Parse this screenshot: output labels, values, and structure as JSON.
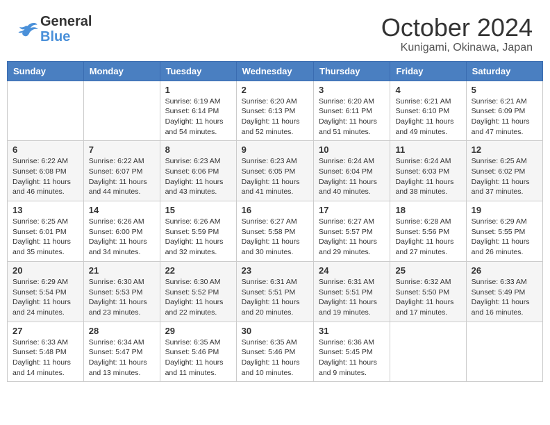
{
  "header": {
    "logo_general": "General",
    "logo_blue": "Blue",
    "month": "October 2024",
    "location": "Kunigami, Okinawa, Japan"
  },
  "calendar": {
    "days_of_week": [
      "Sunday",
      "Monday",
      "Tuesday",
      "Wednesday",
      "Thursday",
      "Friday",
      "Saturday"
    ],
    "weeks": [
      [
        {
          "day": "",
          "info": ""
        },
        {
          "day": "",
          "info": ""
        },
        {
          "day": "1",
          "info": "Sunrise: 6:19 AM\nSunset: 6:14 PM\nDaylight: 11 hours and 54 minutes."
        },
        {
          "day": "2",
          "info": "Sunrise: 6:20 AM\nSunset: 6:13 PM\nDaylight: 11 hours and 52 minutes."
        },
        {
          "day": "3",
          "info": "Sunrise: 6:20 AM\nSunset: 6:11 PM\nDaylight: 11 hours and 51 minutes."
        },
        {
          "day": "4",
          "info": "Sunrise: 6:21 AM\nSunset: 6:10 PM\nDaylight: 11 hours and 49 minutes."
        },
        {
          "day": "5",
          "info": "Sunrise: 6:21 AM\nSunset: 6:09 PM\nDaylight: 11 hours and 47 minutes."
        }
      ],
      [
        {
          "day": "6",
          "info": "Sunrise: 6:22 AM\nSunset: 6:08 PM\nDaylight: 11 hours and 46 minutes."
        },
        {
          "day": "7",
          "info": "Sunrise: 6:22 AM\nSunset: 6:07 PM\nDaylight: 11 hours and 44 minutes."
        },
        {
          "day": "8",
          "info": "Sunrise: 6:23 AM\nSunset: 6:06 PM\nDaylight: 11 hours and 43 minutes."
        },
        {
          "day": "9",
          "info": "Sunrise: 6:23 AM\nSunset: 6:05 PM\nDaylight: 11 hours and 41 minutes."
        },
        {
          "day": "10",
          "info": "Sunrise: 6:24 AM\nSunset: 6:04 PM\nDaylight: 11 hours and 40 minutes."
        },
        {
          "day": "11",
          "info": "Sunrise: 6:24 AM\nSunset: 6:03 PM\nDaylight: 11 hours and 38 minutes."
        },
        {
          "day": "12",
          "info": "Sunrise: 6:25 AM\nSunset: 6:02 PM\nDaylight: 11 hours and 37 minutes."
        }
      ],
      [
        {
          "day": "13",
          "info": "Sunrise: 6:25 AM\nSunset: 6:01 PM\nDaylight: 11 hours and 35 minutes."
        },
        {
          "day": "14",
          "info": "Sunrise: 6:26 AM\nSunset: 6:00 PM\nDaylight: 11 hours and 34 minutes."
        },
        {
          "day": "15",
          "info": "Sunrise: 6:26 AM\nSunset: 5:59 PM\nDaylight: 11 hours and 32 minutes."
        },
        {
          "day": "16",
          "info": "Sunrise: 6:27 AM\nSunset: 5:58 PM\nDaylight: 11 hours and 30 minutes."
        },
        {
          "day": "17",
          "info": "Sunrise: 6:27 AM\nSunset: 5:57 PM\nDaylight: 11 hours and 29 minutes."
        },
        {
          "day": "18",
          "info": "Sunrise: 6:28 AM\nSunset: 5:56 PM\nDaylight: 11 hours and 27 minutes."
        },
        {
          "day": "19",
          "info": "Sunrise: 6:29 AM\nSunset: 5:55 PM\nDaylight: 11 hours and 26 minutes."
        }
      ],
      [
        {
          "day": "20",
          "info": "Sunrise: 6:29 AM\nSunset: 5:54 PM\nDaylight: 11 hours and 24 minutes."
        },
        {
          "day": "21",
          "info": "Sunrise: 6:30 AM\nSunset: 5:53 PM\nDaylight: 11 hours and 23 minutes."
        },
        {
          "day": "22",
          "info": "Sunrise: 6:30 AM\nSunset: 5:52 PM\nDaylight: 11 hours and 22 minutes."
        },
        {
          "day": "23",
          "info": "Sunrise: 6:31 AM\nSunset: 5:51 PM\nDaylight: 11 hours and 20 minutes."
        },
        {
          "day": "24",
          "info": "Sunrise: 6:31 AM\nSunset: 5:51 PM\nDaylight: 11 hours and 19 minutes."
        },
        {
          "day": "25",
          "info": "Sunrise: 6:32 AM\nSunset: 5:50 PM\nDaylight: 11 hours and 17 minutes."
        },
        {
          "day": "26",
          "info": "Sunrise: 6:33 AM\nSunset: 5:49 PM\nDaylight: 11 hours and 16 minutes."
        }
      ],
      [
        {
          "day": "27",
          "info": "Sunrise: 6:33 AM\nSunset: 5:48 PM\nDaylight: 11 hours and 14 minutes."
        },
        {
          "day": "28",
          "info": "Sunrise: 6:34 AM\nSunset: 5:47 PM\nDaylight: 11 hours and 13 minutes."
        },
        {
          "day": "29",
          "info": "Sunrise: 6:35 AM\nSunset: 5:46 PM\nDaylight: 11 hours and 11 minutes."
        },
        {
          "day": "30",
          "info": "Sunrise: 6:35 AM\nSunset: 5:46 PM\nDaylight: 11 hours and 10 minutes."
        },
        {
          "day": "31",
          "info": "Sunrise: 6:36 AM\nSunset: 5:45 PM\nDaylight: 11 hours and 9 minutes."
        },
        {
          "day": "",
          "info": ""
        },
        {
          "day": "",
          "info": ""
        }
      ]
    ]
  }
}
